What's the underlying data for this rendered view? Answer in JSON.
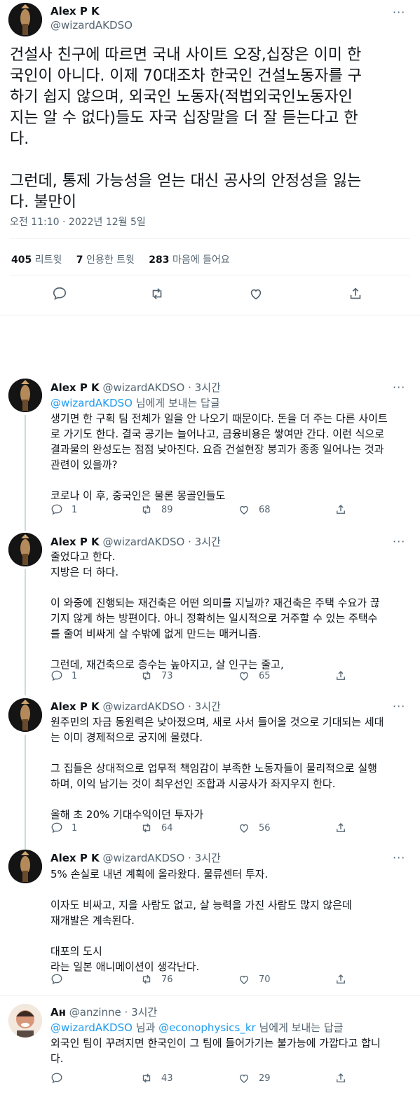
{
  "main_tweet": {
    "author_name": "Alex P K",
    "author_handle": "@wizardAKDSO",
    "more": "···",
    "body": "건설사 친구에 따르면 국내 사이트 오장,십장은 이미 한\n국인이 아니다. 이제 70대조차 한국인 건설노동자를 구\n하기 쉽지 않으며, 외국인 노동자(적법외국인노동자인\n지는 알 수 없다)들도 자국 십장말을 더 잘 듣는다고 한\n다.\n\n그런데, 통제 가능성을 얻는 대신 공사의 안정성을 잃는\n다. 불만이",
    "timestamp": "오전 11:10 · 2022년 12월 5일",
    "stats": {
      "retweets_count": "405",
      "retweets_label": "리트윗",
      "quotes_count": "7",
      "quotes_label": "인용한 트윗",
      "likes_count": "283",
      "likes_label": "마음에 들어요"
    }
  },
  "replies": [
    {
      "author_name": "Alex P K",
      "author_handle": "@wizardAKDSO",
      "time": "· 3시간",
      "reply_to_handle": "@wizardAKDSO",
      "reply_to_suffix": "님에게 보내는 답글",
      "body": "생기면 한 구획 팀 전체가 일을 안 나오기 때문이다. 돈을 더 주는 다른 사이트\n로 가기도 한다. 결국 공기는 늘어나고, 금융비용은 쌓여만 간다. 이런 식으로\n결과물의 완성도는 점점 낮아진다. 요즘 건설현장 붕괴가 종종 일어나는 것과\n관련이 있을까?\n\n코로나 이 후, 중국인은 물론 몽골인들도",
      "replies": "1",
      "retweets": "89",
      "likes": "68"
    },
    {
      "author_name": "Alex P K",
      "author_handle": "@wizardAKDSO",
      "time": "· 3시간",
      "body": "줄었다고 한다.\n지방은 더 하다.\n\n이 와중에 진행되는 재건축은 어떤 의미를 지닐까? 재건축은 주택 수요가 끊\n기지 않게 하는 방편이다. 아니 정확히는 일시적으로 거주할 수 있는 주택수\n를 줄여 비싸게 살 수밖에 없게 만드는 매커니즘.\n\n그런데, 재건축으로 층수는 높아지고, 살 인구는 줄고,",
      "replies": "1",
      "retweets": "73",
      "likes": "65"
    },
    {
      "author_name": "Alex P K",
      "author_handle": "@wizardAKDSO",
      "time": "· 3시간",
      "body": "원주민의 자금 동원력은 낮아졌으며, 새로 사서 들어올 것으로 기대되는 세대\n는 이미 경제적으로 궁지에 몰렸다.\n\n그 집들은 상대적으로 업무적 책임감이 부족한 노동자들이 물리적으로 실행\n하며, 이익 남기는 것이 최우선인 조합과 시공사가 좌지우지 한다.\n\n올해 초 20% 기대수익이던 투자가",
      "replies": "1",
      "retweets": "64",
      "likes": "56"
    },
    {
      "author_name": "Alex P K",
      "author_handle": "@wizardAKDSO",
      "time": "· 3시간",
      "body": "5% 손실로 내년 계획에 올라왔다. 물류센터 투자.\n\n이자도 비싸고, 지을 사람도 없고, 살 능력을 가진 사람도 많지 않은데\n재개발은 계속된다.\n\n대포의 도시\n라는 일본 애니메이션이 생각난다.",
      "replies": "",
      "retweets": "76",
      "likes": "70"
    },
    {
      "author_name": "Ан",
      "author_handle": "@anzinne",
      "time": "· 3시간",
      "reply_to_handle": "@wizardAKDSO",
      "reply_to_mid": "님과",
      "reply_to_handle2": "@econophysics_kr",
      "reply_to_suffix": "님에게 보내는 답글",
      "body": "외국인 팀이 꾸려지면 한국인이 그 팀에 들어가기는 불가능에 가깝다고 합니\n다.",
      "replies": "",
      "retweets": "43",
      "likes": "29"
    }
  ]
}
